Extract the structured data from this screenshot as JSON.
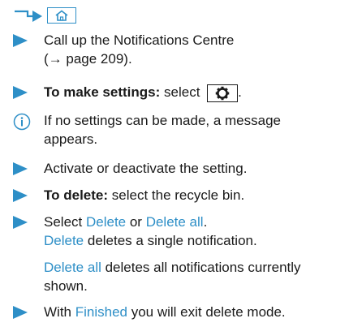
{
  "colors": {
    "accent": "#2e8fc7",
    "text": "#1a1a1a"
  },
  "header": {
    "arrow_icon": "path-arrow-icon",
    "home_icon": "home-icon"
  },
  "steps": {
    "s1_line1": "Call up the Notifications Centre",
    "s1_line2": "(→ page 209).",
    "s2_bold": "To make settings:",
    "s2_text": "select",
    "s2_icon": "gear-icon"
  },
  "info": {
    "icon": "info-icon",
    "line1": "If no settings can be made, a message",
    "line2": "appears."
  },
  "steps2": {
    "s3": "Activate or deactivate the setting.",
    "s4_bold": "To delete:",
    "s4_text": "select the recycle bin.",
    "s5_pre": "Select ",
    "s5_delete": "Delete",
    "s5_mid": " or ",
    "s5_delete_all": "Delete all",
    "s5_end": ".",
    "s5b_delete": "Delete",
    "s5b_text": " deletes a single notification.",
    "s5c_delete_all": "Delete all",
    "s5c_text1": " deletes all notifications currently",
    "s5c_text2": "shown.",
    "s6_pre": "With ",
    "s6_finished": "Finished",
    "s6_text": " you will exit delete mode."
  }
}
